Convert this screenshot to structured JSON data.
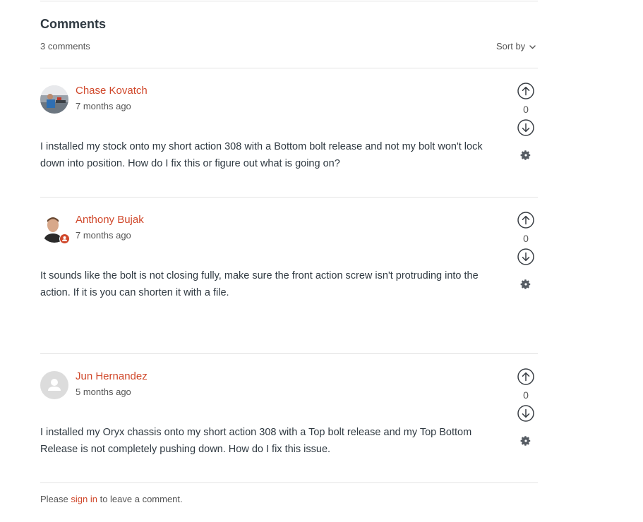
{
  "section": {
    "title": "Comments",
    "count_label": "3 comments",
    "sort_label": "Sort by"
  },
  "comments": [
    {
      "author": "Chase Kovatch",
      "time": "7 months ago",
      "body": "I installed my stock onto my short action 308 with a Bottom bolt release and not my bolt won't lock down into position. How do I fix this or figure out what is going on?",
      "votes": "0",
      "avatar": "photo-avatar-icon"
    },
    {
      "author": "Anthony Bujak",
      "time": "7 months ago",
      "body": "It sounds like the bolt is not closing fully, make sure the front action screw isn't protruding into the action. If it is you can shorten it with a file.",
      "votes": "0",
      "avatar": "photo-avatar-icon",
      "badge": "agent-badge-icon"
    },
    {
      "author": "Jun Hernandez",
      "time": "5 months ago",
      "body": "I installed my Oryx chassis onto my short action 308 with a Top bolt release and my Top Bottom Release is not completely pushing down. How do I fix this issue.",
      "votes": "0",
      "avatar": "default-user-avatar-icon"
    }
  ],
  "footer": {
    "prefix": "Please",
    "link": "sign in",
    "suffix": "to leave a comment."
  },
  "colors": {
    "accent": "#d0482b",
    "text": "#2f3941",
    "muted": "#555555",
    "divider": "#e3e3e3"
  }
}
